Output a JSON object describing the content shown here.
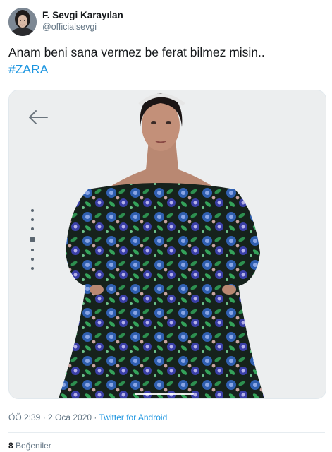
{
  "author": {
    "name": "F. Sevgi Karayılan",
    "handle": "@officialsevgi"
  },
  "tweet": {
    "text": "Anam beni sana vermez be ferat bilmez misin..",
    "hashtag": "#ZARA"
  },
  "media": {
    "description_icon": "arrow-left-icon",
    "carousel": {
      "count": 7,
      "active_index": 4
    }
  },
  "meta": {
    "time": "ÖÖ 2:39",
    "separator": " · ",
    "date": "2 Oca 2020",
    "source": "Twitter for Android"
  },
  "stats": {
    "likes_count": "8",
    "likes_label": "Beğeniler"
  },
  "colors": {
    "link": "#1b95e0",
    "secondary_text": "#657786",
    "primary_text": "#14171a"
  }
}
